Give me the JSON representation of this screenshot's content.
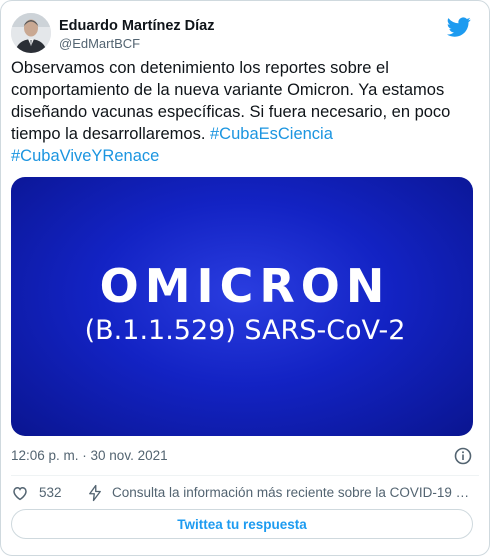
{
  "author": {
    "display_name": "Eduardo Martínez Díaz",
    "handle": "@EdMartBCF"
  },
  "tweet": {
    "text": "Observamos con detenimiento los reportes sobre el comportamiento de la nueva variante Omicron. Ya estamos diseñando vacunas específicas. Si fuera necesario, en poco tiempo la desarrollaremos. ",
    "hashtags": [
      "#CubaEsCiencia",
      "#CubaViveYRenace"
    ]
  },
  "media": {
    "title": "OMICRON",
    "subtitle": "(B.1.1.529) SARS-CoV-2"
  },
  "meta": {
    "timestamp": "12:06 p. m. · 30 nov. 2021"
  },
  "actions": {
    "like_count": "532",
    "covid_notice": "Consulta la información más reciente sobre la COVID-19 en..."
  },
  "reply_button": {
    "label": "Twittea tu respuesta"
  },
  "colors": {
    "accent": "#1d9bf0",
    "hashtag": "#1b95e0",
    "media_bg": "#1323c4",
    "text": "#0f1419",
    "secondary": "#536471"
  },
  "icons": [
    "twitter-bird-icon",
    "info-icon",
    "heart-icon",
    "lightning-icon"
  ]
}
